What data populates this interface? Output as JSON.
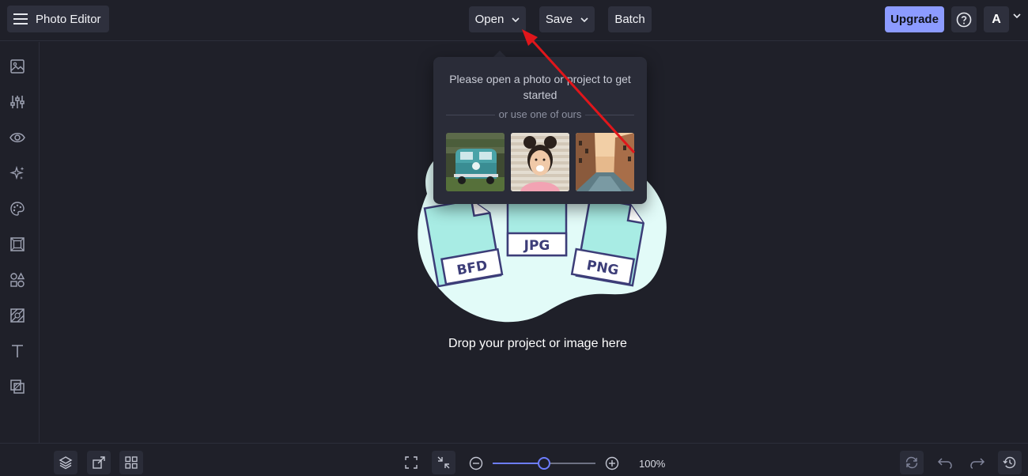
{
  "header": {
    "app_title": "Photo Editor",
    "menus": [
      {
        "label": "Open"
      },
      {
        "label": "Save"
      },
      {
        "label": "Batch"
      }
    ],
    "upgrade_label": "Upgrade",
    "account_initial": "A"
  },
  "sidebar": {
    "items": [
      "image-icon",
      "adjust-sliders-icon",
      "eye-icon",
      "sparkle-icon",
      "palette-icon",
      "frame-icon",
      "shapes-icon",
      "texture-icon",
      "text-icon",
      "overlay-icon"
    ]
  },
  "open_popover": {
    "message": "Please open a photo or project to get started",
    "alt_text": "or use one of ours",
    "samples": [
      "van-photo",
      "smiling-woman-photo",
      "venice-canal-photo"
    ]
  },
  "drop_zone": {
    "file_types": [
      "BFD",
      "JPG",
      "PNG"
    ],
    "text": "Drop your project or image here"
  },
  "bottom": {
    "zoom_percent": 100,
    "zoom_label": "100%"
  },
  "colors": {
    "background": "#1f2029",
    "accent": "#8c9bff",
    "annotation_arrow": "#e0161b"
  }
}
